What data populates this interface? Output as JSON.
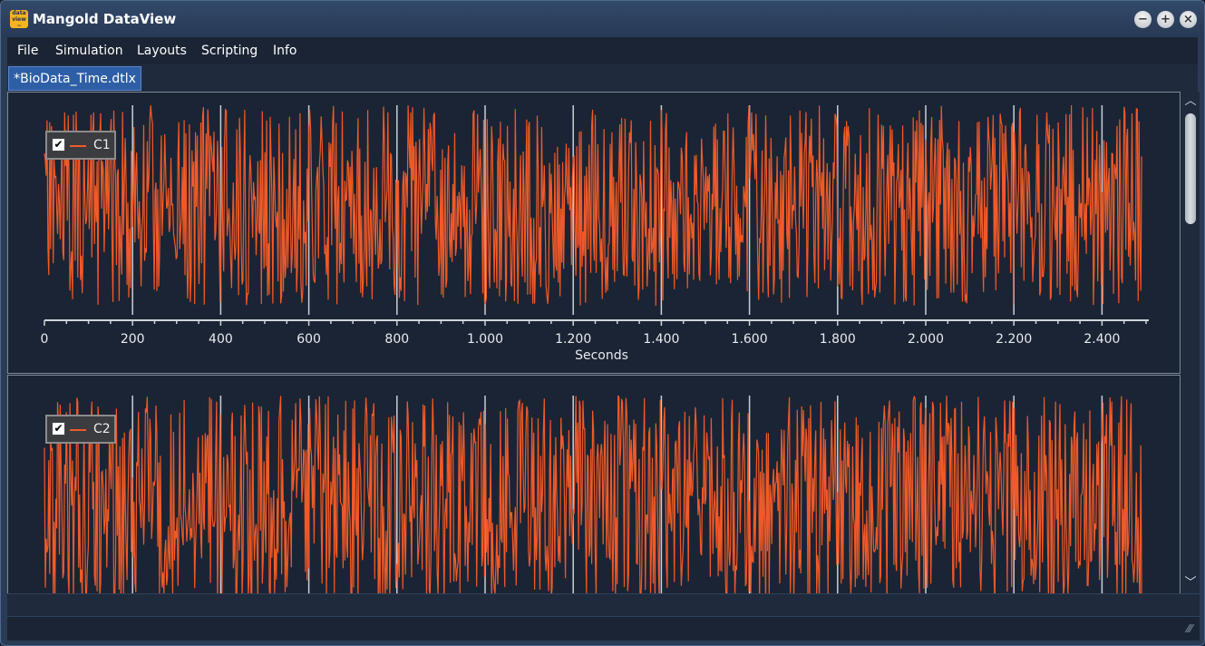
{
  "window": {
    "title": "Mangold DataView",
    "app_icon": "dataview-logo-icon",
    "controls": [
      "minimize",
      "maximize",
      "close"
    ]
  },
  "menu": [
    "File",
    "Simulation",
    "Layouts",
    "Scripting",
    "Info"
  ],
  "tabs": [
    {
      "label": "*BioData_Time.dtlx",
      "active": true
    }
  ],
  "colors": {
    "series": "#f05a28",
    "background": "#1b2434",
    "tab_active": "#2e5fa6"
  },
  "chart_data": [
    {
      "type": "line",
      "title": "",
      "legend": {
        "entries": [
          "C1"
        ],
        "checked": true,
        "placement": "top-left"
      },
      "xlabel": "Seconds",
      "ylabel": "",
      "xlim": [
        0,
        2500
      ],
      "xticks": [
        0,
        200,
        400,
        600,
        800,
        1000,
        1200,
        1400,
        1600,
        1800,
        2000,
        2200,
        2400
      ],
      "xtick_labels": [
        "0",
        "200",
        "400",
        "600",
        "800",
        "1.000",
        "1.200",
        "1.400",
        "1.600",
        "1.800",
        "2.000",
        "2.200",
        "2.400"
      ],
      "grid": "vertical",
      "series": [
        {
          "name": "C1",
          "description": "dense random noise signal spanning full y range",
          "samples": 1250,
          "seed": 11
        }
      ]
    },
    {
      "type": "line",
      "title": "",
      "legend": {
        "entries": [
          "C2"
        ],
        "checked": true,
        "placement": "top-left"
      },
      "xlabel": "",
      "xlim": [
        0,
        2500
      ],
      "xticks": [
        0,
        200,
        400,
        600,
        800,
        1000,
        1200,
        1400,
        1600,
        1800,
        2000,
        2200,
        2400
      ],
      "grid": "vertical",
      "series": [
        {
          "name": "C2",
          "description": "dense random noise signal spanning full y range",
          "samples": 1250,
          "seed": 29
        }
      ]
    }
  ]
}
